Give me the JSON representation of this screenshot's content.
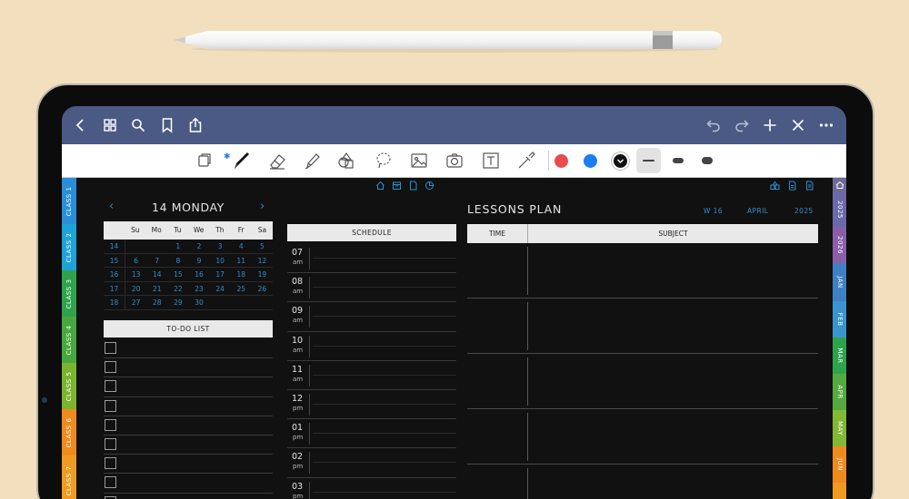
{
  "colors": {
    "background": "#f1dfbd",
    "navbar": "#4b5a85",
    "accent": "#2e8fd0",
    "swatch_red": "#e84c4c",
    "swatch_blue": "#1b7ef0",
    "swatch_black": "#111111"
  },
  "navbar": {
    "left_icons": [
      "back-icon",
      "grid-icon",
      "search-icon",
      "bookmark-icon",
      "share-icon"
    ],
    "right_icons": [
      "undo-icon",
      "redo-icon",
      "plus-icon",
      "close-icon",
      "more-icon"
    ]
  },
  "toolbar": {
    "tools": [
      "read-mode-icon",
      "pen-icon",
      "eraser-icon",
      "highlighter-icon",
      "shapes-icon",
      "lasso-icon",
      "image-icon",
      "camera-icon",
      "text-icon",
      "laser-icon"
    ],
    "strokes": [
      "thin",
      "medium",
      "thick"
    ]
  },
  "left_tabs": [
    {
      "label": "CLASS 1",
      "color": "#2a8fd8"
    },
    {
      "label": "CLASS 2",
      "color": "#1fa3d6"
    },
    {
      "label": "CLASS 3",
      "color": "#2fa34c"
    },
    {
      "label": "CLASS 4",
      "color": "#48a83f"
    },
    {
      "label": "CLASS 5",
      "color": "#7ab530"
    },
    {
      "label": "CLASS 6",
      "color": "#ef8a1f"
    },
    {
      "label": "CLASS 7",
      "color": "#ef9a22"
    }
  ],
  "right_tabs": [
    {
      "label": "",
      "color": "#6e6a96"
    },
    {
      "label": "2025",
      "color": "#6a6aa8"
    },
    {
      "label": "2026",
      "color": "#8a5fa8"
    },
    {
      "label": "JAN",
      "color": "#3f80c4"
    },
    {
      "label": "FEB",
      "color": "#3a95cf"
    },
    {
      "label": "MAR",
      "color": "#2fa34c"
    },
    {
      "label": "APR",
      "color": "#55aa3f"
    },
    {
      "label": "MAY",
      "color": "#82b836"
    },
    {
      "label": "JUN",
      "color": "#ef8a1f"
    },
    {
      "label": "",
      "color": "#ef9a22"
    }
  ],
  "day": {
    "date_label": "14 MONDAY",
    "prev_arrow": "‹",
    "next_arrow": "›"
  },
  "calendar": {
    "headers": [
      "",
      "Su",
      "Mo",
      "Tu",
      "We",
      "Th",
      "Fr",
      "Sa"
    ],
    "weeks": [
      [
        "14",
        "",
        "",
        "1",
        "2",
        "3",
        "4",
        "5"
      ],
      [
        "15",
        "6",
        "7",
        "8",
        "9",
        "10",
        "11",
        "12"
      ],
      [
        "16",
        "13",
        "14",
        "15",
        "16",
        "17",
        "18",
        "19"
      ],
      [
        "17",
        "20",
        "21",
        "22",
        "23",
        "24",
        "25",
        "26"
      ],
      [
        "18",
        "27",
        "28",
        "29",
        "30",
        "",
        "",
        ""
      ]
    ]
  },
  "todo": {
    "title": "TO-DO LIST",
    "count": 9
  },
  "schedule": {
    "title": "SCHEDULE",
    "slots": [
      {
        "hour": "07",
        "ampm": "am"
      },
      {
        "hour": "08",
        "ampm": "am"
      },
      {
        "hour": "09",
        "ampm": "am"
      },
      {
        "hour": "10",
        "ampm": "am"
      },
      {
        "hour": "11",
        "ampm": "am"
      },
      {
        "hour": "12",
        "ampm": "pm"
      },
      {
        "hour": "01",
        "ampm": "pm"
      },
      {
        "hour": "02",
        "ampm": "pm"
      },
      {
        "hour": "03",
        "ampm": "pm"
      }
    ]
  },
  "lessons": {
    "title": "LESSONS PLAN",
    "week": "W 16",
    "month": "APRIL",
    "year": "2025",
    "col_time": "TIME",
    "col_subject": "SUBJECT",
    "rows": 5
  }
}
